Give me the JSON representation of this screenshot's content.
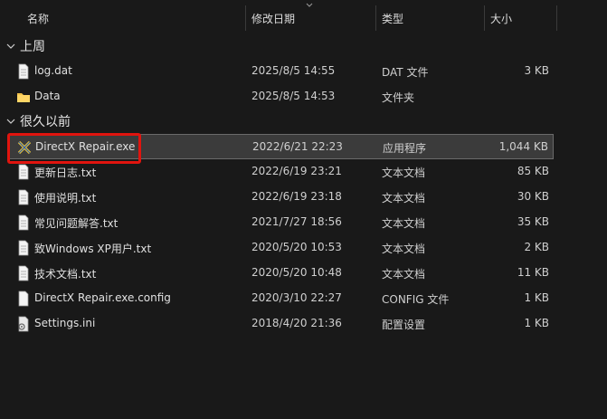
{
  "columns": {
    "name": "名称",
    "date": "修改日期",
    "type": "类型",
    "size": "大小"
  },
  "groups": [
    {
      "label": "上周",
      "files": [
        {
          "name": "log.dat",
          "date": "2025/8/5 14:55",
          "type": "DAT 文件",
          "size": "3 KB",
          "icon": "doc-icon"
        },
        {
          "name": "Data",
          "date": "2025/8/5 14:53",
          "type": "文件夹",
          "size": "",
          "icon": "folder-icon"
        }
      ]
    },
    {
      "label": "很久以前",
      "files": [
        {
          "name": "DirectX Repair.exe",
          "date": "2022/6/21 22:23",
          "type": "应用程序",
          "size": "1,044 KB",
          "icon": "app-icon",
          "selected": true
        },
        {
          "name": "更新日志.txt",
          "date": "2022/6/19 23:21",
          "type": "文本文档",
          "size": "85 KB",
          "icon": "doc-icon"
        },
        {
          "name": "使用说明.txt",
          "date": "2022/6/19 23:18",
          "type": "文本文档",
          "size": "30 KB",
          "icon": "doc-icon"
        },
        {
          "name": "常见问题解答.txt",
          "date": "2021/7/27 18:56",
          "type": "文本文档",
          "size": "35 KB",
          "icon": "doc-icon"
        },
        {
          "name": "致Windows XP用户.txt",
          "date": "2020/5/20 10:53",
          "type": "文本文档",
          "size": "2 KB",
          "icon": "doc-icon"
        },
        {
          "name": "技术文档.txt",
          "date": "2020/5/20 10:48",
          "type": "文本文档",
          "size": "11 KB",
          "icon": "doc-icon"
        },
        {
          "name": "DirectX Repair.exe.config",
          "date": "2020/3/10 22:27",
          "type": "CONFIG 文件",
          "size": "1 KB",
          "icon": "doc-icon"
        },
        {
          "name": "Settings.ini",
          "date": "2018/4/20 21:36",
          "type": "配置设置",
          "size": "1 KB",
          "icon": "settings-file-icon"
        }
      ]
    }
  ],
  "colors": {
    "background": "#191919",
    "selection": "#3b3b3b",
    "highlight": "#e0140e",
    "folder": "#f2c14b"
  }
}
